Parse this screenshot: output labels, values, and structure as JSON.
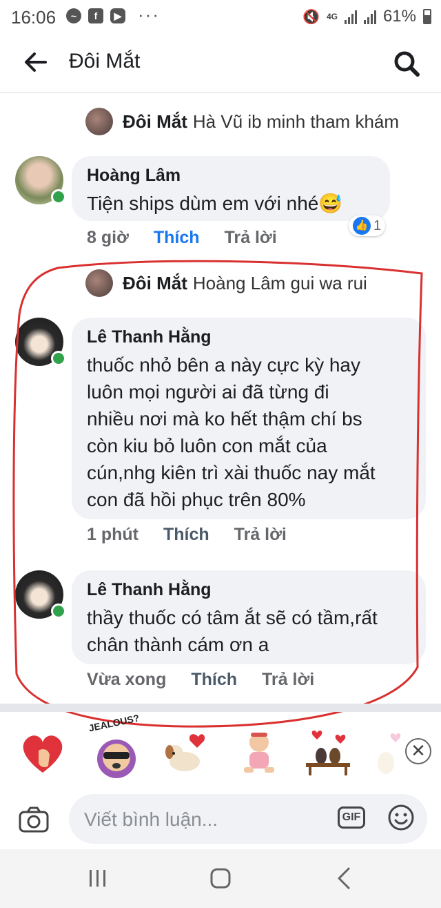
{
  "status_bar": {
    "time": "16:06",
    "network": "4G",
    "battery": "61%"
  },
  "header": {
    "title": "Đôi Mắt"
  },
  "thread": [
    {
      "type": "reply-preview",
      "author": "Đôi Mắt",
      "text": "Hà Vũ ib minh tham khám"
    },
    {
      "type": "comment",
      "author": "Hoàng Lâm",
      "text": "Tiện ships dùm em với nhé😅",
      "time": "8 giờ",
      "like": "Thích",
      "reply": "Trả lời",
      "reaction_count": "1"
    },
    {
      "type": "reply-preview",
      "author": "Đôi Mắt",
      "text": "Hoàng Lâm gui wa rui"
    },
    {
      "type": "comment",
      "author": "Lê Thanh Hằng",
      "text_lines": [
        "thuốc nhỏ bên a này cực kỳ hay",
        "luôn mọi người ai đã từng đi",
        "nhiều nơi mà ko hết thậm chí bs",
        "còn kiu bỏ luôn con mắt của",
        "cún,nhg kiên trì xài thuốc nay mắt",
        "con đã hồi phục trên 80%"
      ],
      "time": "1 phút",
      "like": "Thích",
      "reply": "Trả lời"
    },
    {
      "type": "comment",
      "author": "Lê Thanh Hằng",
      "text_lines": [
        "thầy thuốc có tâm ắt sẽ có tầm,rất",
        "chân thành cám ơn a"
      ],
      "time": "Vừa xong",
      "like": "Thích",
      "reply": "Trả lời"
    }
  ],
  "stickers": {
    "jealous_label": "JEALOUS?"
  },
  "composer": {
    "placeholder": "Viết bình luận...",
    "gif_label": "GIF"
  },
  "colors": {
    "accent": "#1877f2",
    "annotation": "#d93030",
    "bubble": "#f0f2f5"
  }
}
